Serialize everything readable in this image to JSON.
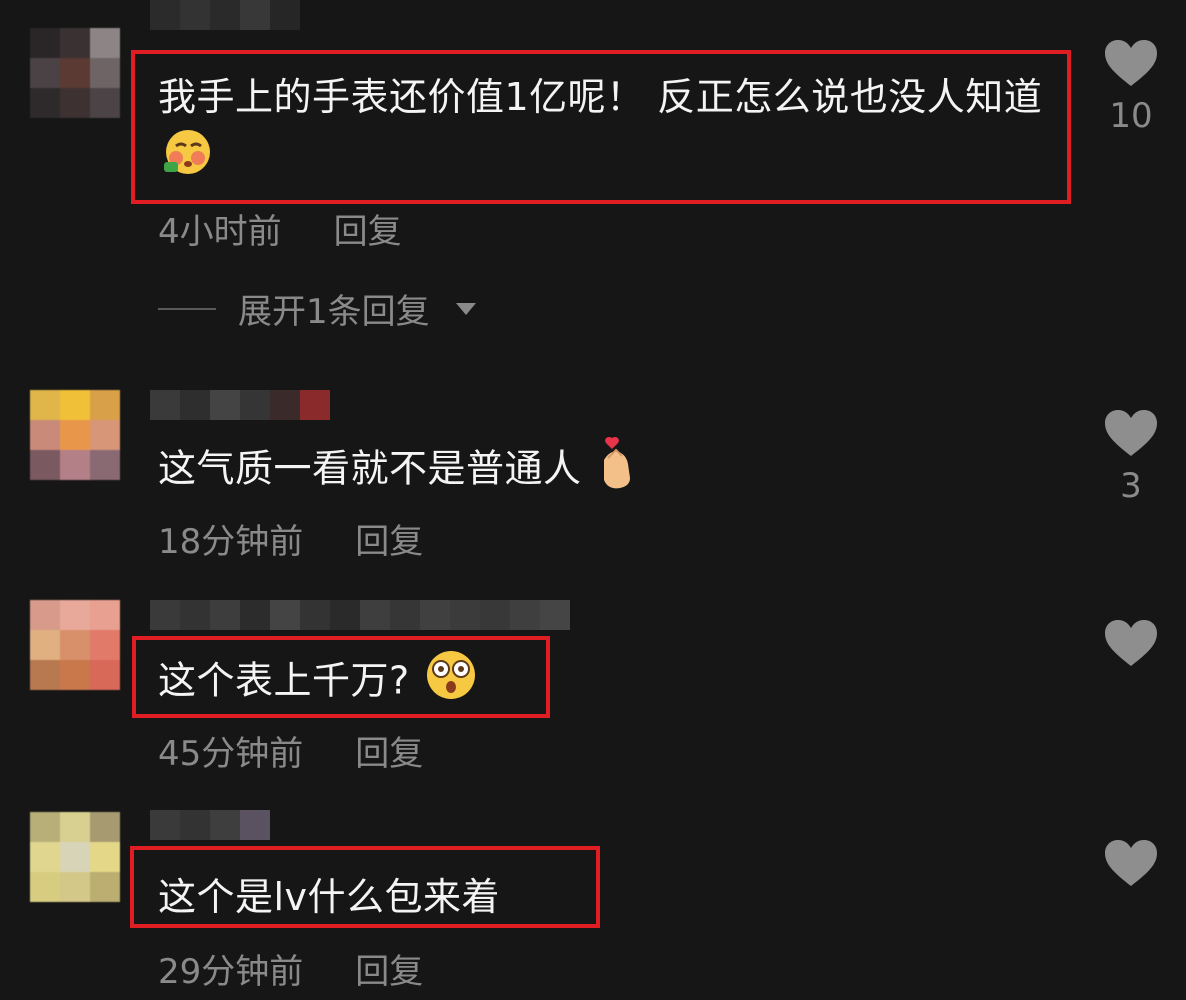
{
  "comments": [
    {
      "text": "我手上的手表还价值1亿呢！ 反正怎么说也没人知道",
      "emoji": "drunk-face-emoji",
      "time": "4小时前",
      "reply_label": "回复",
      "likes": "10",
      "highlighted": true
    },
    {
      "text": "这气质一看就不是普通人",
      "emoji": "finger-heart-emoji",
      "time": "18分钟前",
      "reply_label": "回复",
      "likes": "3",
      "highlighted": false
    },
    {
      "text": "这个表上千万?",
      "emoji": "shocked-face-emoji",
      "time": "45分钟前",
      "reply_label": "回复",
      "likes": "",
      "highlighted": true
    },
    {
      "text": "这个是lv什么包来着",
      "emoji": "",
      "time": "29分钟前",
      "reply_label": "回复",
      "likes": "",
      "highlighted": true
    }
  ],
  "expand_replies": "展开1条回复",
  "colors": {
    "background": "#161616",
    "highlight_border": "#e11d24",
    "meta_text": "#8a8a8a"
  }
}
